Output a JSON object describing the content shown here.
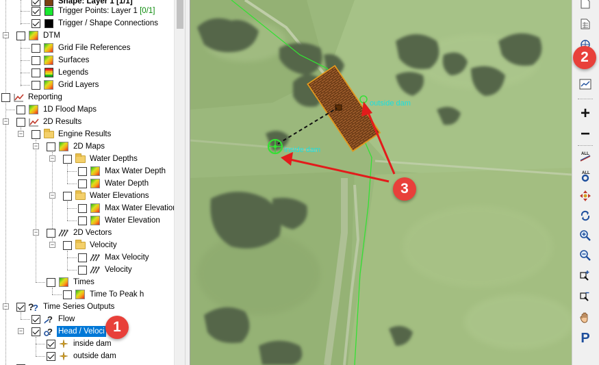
{
  "tree": {
    "shape_layer_label": "Shape: Layer 1 [1/1]",
    "trigger_points_label": "Trigger Points: Layer 1",
    "trigger_points_count": "[0/1]",
    "trigger_connections_label": "Trigger / Shape Connections",
    "dtm_label": "DTM",
    "grid_file_references_label": "Grid File References",
    "surfaces_label": "Surfaces",
    "legends_label": "Legends",
    "grid_layers_label": "Grid Layers",
    "reporting_label": "Reporting",
    "flood_maps_1d_label": "1D Flood Maps",
    "results_2d_label": "2D Results",
    "engine_results_label": "Engine Results",
    "maps_2d_label": "2D Maps",
    "water_depths_label": "Water Depths",
    "max_water_depth_label": "Max Water Depth",
    "water_depth_label": "Water Depth",
    "water_elevations_label": "Water Elevations",
    "max_water_elevation_label": "Max Water Elevation",
    "water_elevation_label": "Water Elevation",
    "vectors_2d_label": "2D Vectors",
    "velocity_folder_label": "Velocity",
    "max_velocity_label": "Max Velocity",
    "velocity_label": "Velocity",
    "times_label": "Times",
    "time_to_peak_label": "Time To Peak h",
    "time_series_outputs_label": "Time Series Outputs",
    "flow_label": "Flow",
    "head_velocity_label": "Head / Veloci",
    "inside_dam_label": "inside dam",
    "outside_dam_label": "outside dam"
  },
  "map": {
    "inside_dam_label": "inside dam",
    "outside_dam_label": "outside dam"
  },
  "toolbar": {
    "zoom_in_symbol": "+",
    "zoom_out_symbol": "−",
    "pan_symbol": "P"
  },
  "badges": {
    "one": "1",
    "two": "2",
    "three": "3"
  },
  "colors": {
    "badge": "#e8403a",
    "selection": "#0078d7",
    "map_label": "#19e0e0",
    "flow_line": "#34e034",
    "arrow": "#e31b1b"
  }
}
